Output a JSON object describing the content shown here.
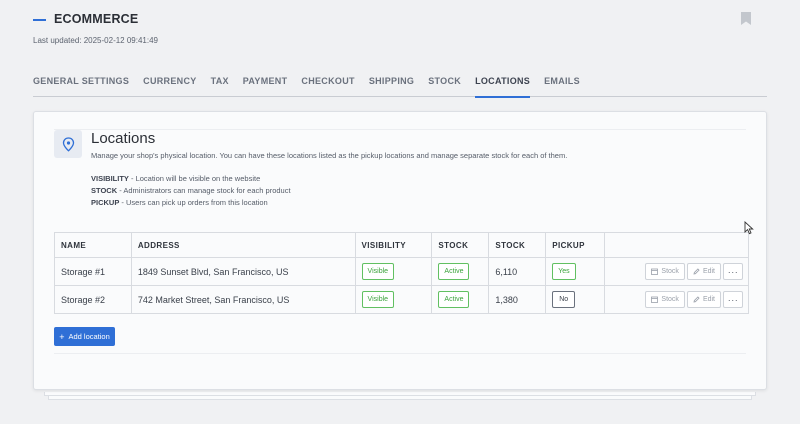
{
  "header": {
    "title": "ECOMMERCE",
    "last_updated": "Last updated: 2025-02-12 09:41:49"
  },
  "tabs": [
    {
      "label": "GENERAL SETTINGS",
      "active": false
    },
    {
      "label": "CURRENCY",
      "active": false
    },
    {
      "label": "TAX",
      "active": false
    },
    {
      "label": "PAYMENT",
      "active": false
    },
    {
      "label": "CHECKOUT",
      "active": false
    },
    {
      "label": "SHIPPING",
      "active": false
    },
    {
      "label": "STOCK",
      "active": false
    },
    {
      "label": "LOCATIONS",
      "active": true
    },
    {
      "label": "EMAILS",
      "active": false
    }
  ],
  "section": {
    "title": "Locations",
    "description": "Manage your shop's physical location. You can have these locations listed as the pickup locations and manage separate stock for each of them.",
    "legend": [
      {
        "term": "VISIBILITY",
        "text": " - Location will be visible on the website"
      },
      {
        "term": "STOCK",
        "text": " - Administrators can manage stock for each product"
      },
      {
        "term": "PICKUP",
        "text": " - Users can pick up orders from this location"
      }
    ]
  },
  "table": {
    "headers": [
      "NAME",
      "ADDRESS",
      "VISIBILITY",
      "STOCK",
      "STOCK",
      "PICKUP",
      ""
    ],
    "rows": [
      {
        "name": "Storage #1",
        "address": "1849 Sunset Blvd, San Francisco, US",
        "visibility": "Visible",
        "stock_status": "Active",
        "stock_qty": "6,110",
        "pickup": "Yes"
      },
      {
        "name": "Storage #2",
        "address": "742 Market Street, San Francisco, US",
        "visibility": "Visible",
        "stock_status": "Active",
        "stock_qty": "1,380",
        "pickup": "No"
      }
    ],
    "actions": {
      "stock": "Stock",
      "edit": "Edit",
      "more": "···"
    }
  },
  "add_button": {
    "label": "Add location"
  },
  "icons": {
    "title": "dash-accent-icon",
    "bookmark": "bookmark-icon",
    "location": "map-pin-icon",
    "cursor": "mouse-pointer-icon"
  },
  "colors": {
    "accent": "#2f6fd6",
    "green": "#3aa33a",
    "background": "#f0f1f3"
  }
}
